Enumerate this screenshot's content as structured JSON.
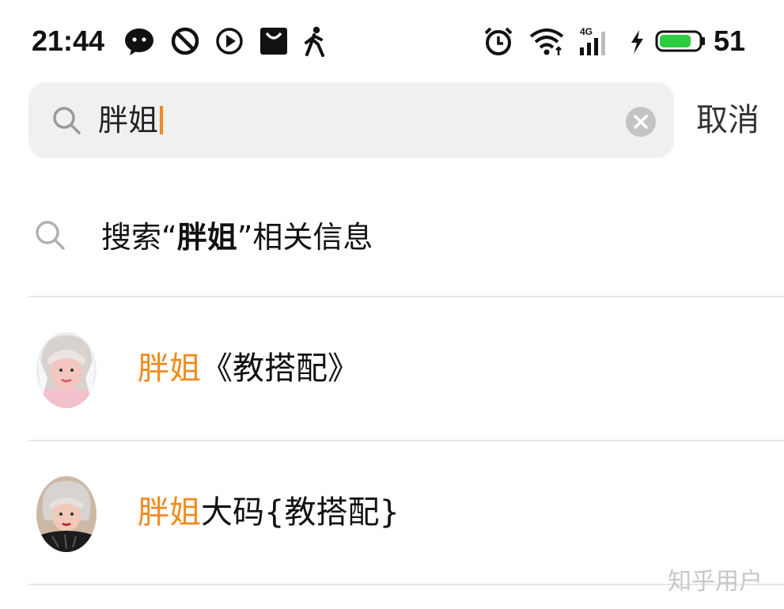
{
  "status_bar": {
    "time": "21:44",
    "network_label": "4G",
    "battery_percent": "51",
    "battery_level": 0.51,
    "battery_color": "#2ecc40",
    "left_icons": [
      "wechat-icon",
      "blocked-icon",
      "play-icon",
      "bag-icon",
      "walking-icon"
    ],
    "right_icons": [
      "alarm-icon",
      "wifi-icon",
      "signal-icon",
      "charging-icon",
      "battery-icon"
    ]
  },
  "search": {
    "query": "胖姐",
    "cancel_label": "取消",
    "caret_color": "#f08a1c"
  },
  "suggestion": {
    "prefix": "搜索“",
    "keyword": "胖姐",
    "suffix": "”相关信息"
  },
  "results": [
    {
      "highlight": "胖姐",
      "rest": "《教搭配》"
    },
    {
      "highlight": "胖姐",
      "rest": "大码{教搭配}"
    }
  ],
  "watermark": "知乎用户",
  "colors": {
    "accent": "#f08a1c",
    "search_bg": "#f0f0f0",
    "divider": "#e6e6e6"
  }
}
